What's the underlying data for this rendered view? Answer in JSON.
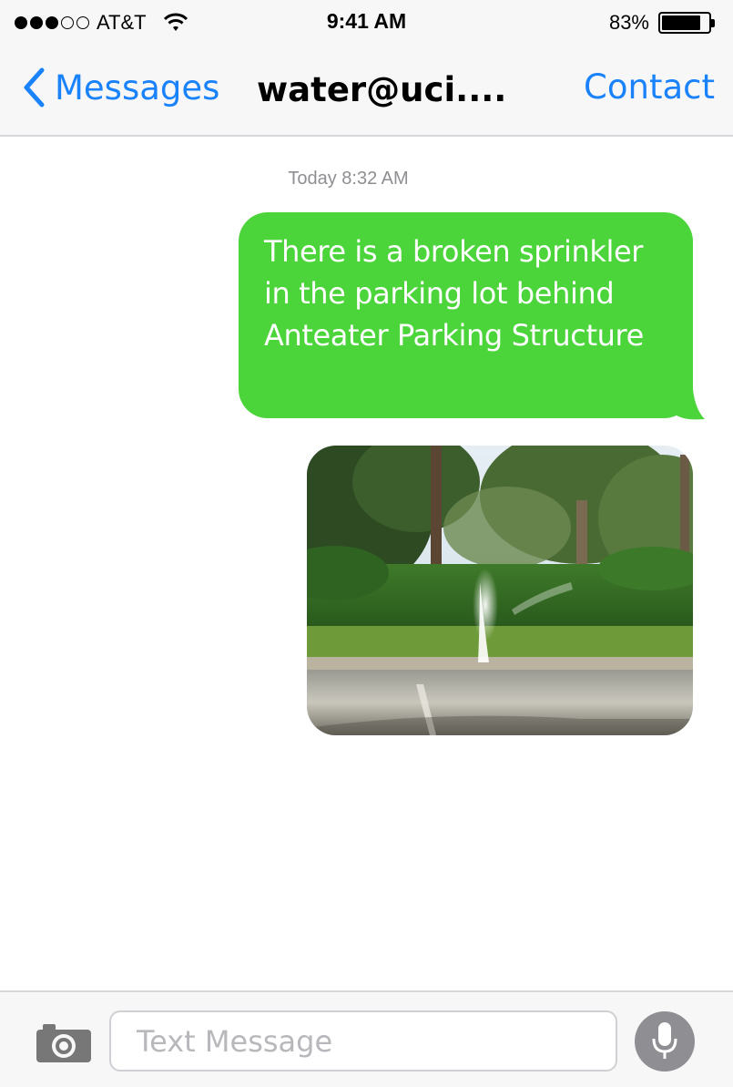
{
  "status_bar": {
    "signal_bars_filled": 3,
    "signal_bars_total": 5,
    "carrier": "AT&T",
    "time": "9:41 AM",
    "battery_percent": "83%",
    "battery_level": 0.83
  },
  "nav": {
    "back_label": "Messages",
    "title": "water@uci....",
    "contact_label": "Contact",
    "accent_color": "#1a82fb"
  },
  "conversation": {
    "timestamp": "Today 8:32 AM",
    "messages": [
      {
        "type": "text",
        "direction": "outgoing",
        "text": "There is a broken sprinkler in the parking lot behind Anteater Parking Structure",
        "bubble_color": "#4cd43b"
      },
      {
        "type": "image",
        "direction": "outgoing",
        "depicts": "broken-sprinkler-photo"
      }
    ]
  },
  "input_bar": {
    "placeholder": "Text Message",
    "value": "",
    "camera_icon": "camera-icon",
    "mic_icon": "microphone-icon"
  }
}
